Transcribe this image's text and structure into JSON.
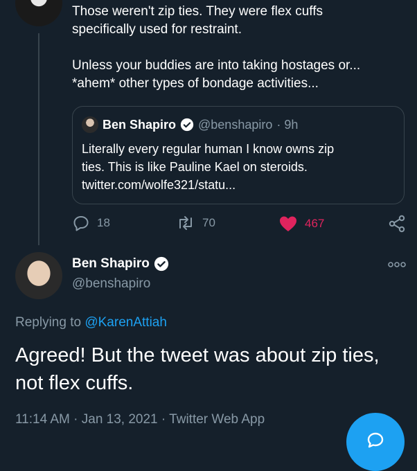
{
  "parent_tweet": {
    "text_line1": "Those weren't zip ties. They were flex cuffs",
    "text_line2": "specifically used for restraint.",
    "text_line3": "Unless your buddies are into taking hostages or...",
    "text_line4": "*ahem* other types of bondage activities...",
    "quote": {
      "name": "Ben Shapiro",
      "handle": "@benshapiro",
      "time": "· 9h",
      "line1": "Literally every regular human I know owns zip",
      "line2": "ties. This is like Pauline Kael on steroids.",
      "line3": "twitter.com/wolfe321/statu..."
    },
    "actions": {
      "replies": "18",
      "retweets": "70",
      "likes": "467"
    }
  },
  "main_tweet": {
    "name": "Ben Shapiro",
    "handle": "@benshapiro",
    "replying_prefix": "Replying to",
    "replying_to": "@KarenAttiah",
    "text_line1": "Agreed! But the tweet was about zip ties,",
    "text_line2": "not flex cuffs.",
    "meta": "11:14 AM · Jan 13, 2021 · Twitter Web App"
  },
  "colors": {
    "background": "#15202b",
    "secondary_text": "#8899a6",
    "accent": "#1da1f2",
    "like": "#e0245e"
  },
  "icons": [
    "verified-badge-icon",
    "reply-icon",
    "retweet-icon",
    "heart-icon",
    "share-icon",
    "more-icon",
    "compose-icon"
  ]
}
